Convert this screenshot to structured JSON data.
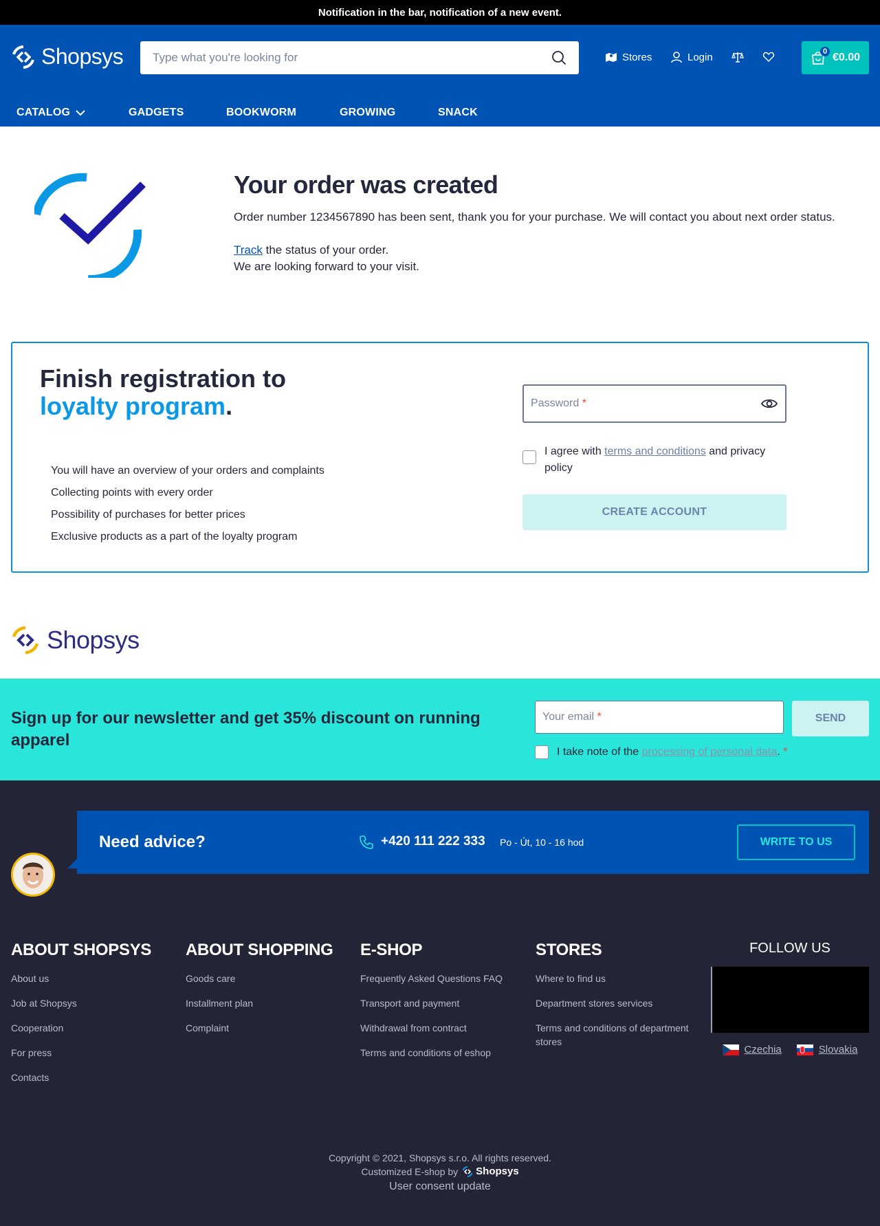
{
  "notification": {
    "text": "Notification in the bar, notification of a new event."
  },
  "header": {
    "logo_text": "Shopsys",
    "search_placeholder": "Type what you're looking for",
    "stores_label": "Stores",
    "login_label": "Login",
    "cart": {
      "count": "0",
      "total": "€0.00"
    }
  },
  "nav": [
    {
      "label": "CATALOG",
      "icon": "chevron-down-icon"
    },
    {
      "label": "GADGETS"
    },
    {
      "label": "BOOKWORM"
    },
    {
      "label": "GROWING"
    },
    {
      "label": "SNACK"
    }
  ],
  "order": {
    "title": "Your order was created",
    "message": "Order number 1234567890 has been sent, thank you for your purchase. We will contact you about next order status.",
    "track_link": "Track",
    "track_rest": " the status of your order.",
    "visit": "We are looking forward to your visit."
  },
  "registration": {
    "title_part1": "Finish registration to ",
    "title_highlight": "loyalty program",
    "title_end": ".",
    "benefits": [
      "You will have an overview of your orders and complaints",
      "Collecting points with every order",
      "Possibility of purchases for better prices",
      "Exclusive products as a part of the loyalty program"
    ],
    "password_label": "Password",
    "required_mark": "*",
    "agree_prefix": "I agree with ",
    "agree_link": "terms and conditions",
    "agree_suffix": " and privacy policy",
    "create_button": "CREATE ACCOUNT"
  },
  "footer_logo_text": "Shopsys",
  "newsletter": {
    "title": "Sign up for our newsletter and get 35% discount on running apparel",
    "email_placeholder": "Your email",
    "required_mark": "*",
    "send_button": "SEND",
    "consent_prefix": "I take note of the ",
    "consent_link": "processing of personal data",
    "consent_suffix": ".",
    "consent_required": "*"
  },
  "advice": {
    "title": "Need advice?",
    "phone": "+420 111 222 333",
    "hours": "Po - Út, 10 - 16 hod",
    "write_button": "WRITE TO US"
  },
  "footer_columns": [
    {
      "title": "ABOUT SHOPSYS",
      "links": [
        "About us",
        "Job at Shopsys",
        "Cooperation",
        "For press",
        "Contacts"
      ]
    },
    {
      "title": "ABOUT SHOPPING",
      "links": [
        "Goods care",
        "Installment plan",
        "Complaint"
      ]
    },
    {
      "title": "E-SHOP",
      "links": [
        "Frequently Asked Questions FAQ",
        "Transport and payment",
        "Withdrawal from contract",
        "Terms and conditions of eshop"
      ]
    },
    {
      "title": "STORES",
      "links": [
        "Where to find us",
        "Department stores services",
        "Terms and conditions of department stores"
      ]
    }
  ],
  "follow": {
    "title": "FOLLOW US",
    "languages": [
      "Czechia",
      "Slovakia"
    ]
  },
  "copyright": {
    "line1": "Copyright © 2021, Shopsys s.r.o. All rights reserved.",
    "line2": "Customized E-shop by",
    "by_logo": "Shopsys",
    "consent_update": "User consent update"
  },
  "colors": {
    "brand_blue": "#0052b3",
    "accent_teal": "#00c3bd",
    "newsletter_bg": "#2ae5d9",
    "footer_bg": "#232537",
    "highlight_blue": "#0b99e6"
  }
}
